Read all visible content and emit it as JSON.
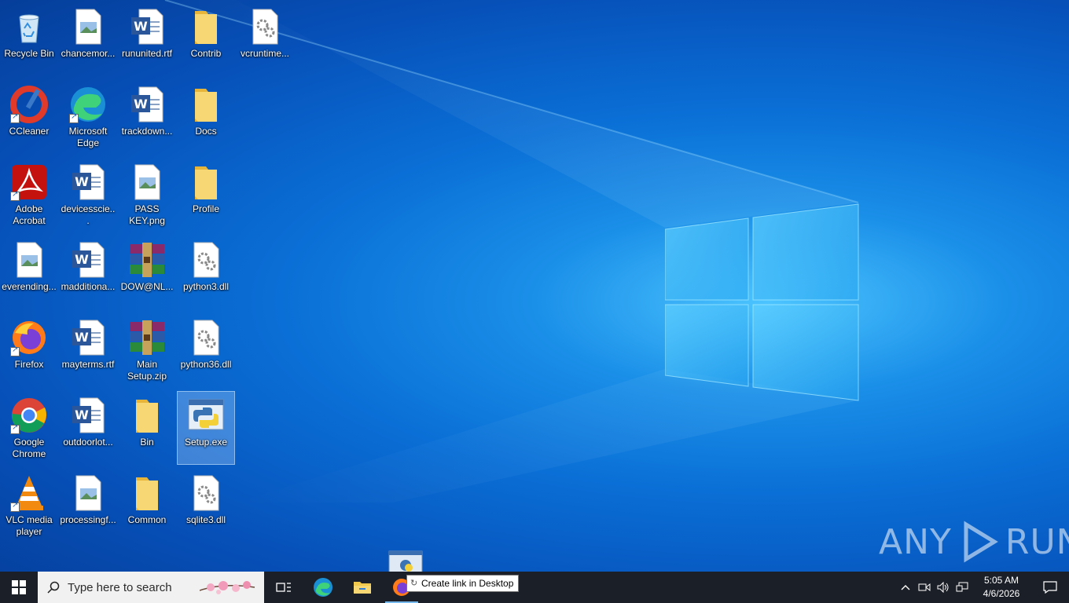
{
  "desktop": {
    "icons": [
      {
        "label": "Recycle Bin",
        "icon": "recycle-bin-icon"
      },
      {
        "label": "chancemor...",
        "icon": "image-file-icon"
      },
      {
        "label": "rununited.rtf",
        "icon": "word-doc-icon"
      },
      {
        "label": "Contrib",
        "icon": "folder-icon"
      },
      {
        "label": "vcruntime...",
        "icon": "dll-file-icon"
      },
      {
        "label": "CCleaner",
        "icon": "ccleaner-icon"
      },
      {
        "label": "Microsoft Edge",
        "icon": "edge-icon"
      },
      {
        "label": "trackdown...",
        "icon": "word-doc-icon"
      },
      {
        "label": "Docs",
        "icon": "folder-icon"
      },
      {
        "label": "Adobe Acrobat",
        "icon": "acrobat-icon"
      },
      {
        "label": "devicesscie...",
        "icon": "word-doc-icon"
      },
      {
        "label": "PASS KEY.png",
        "icon": "image-file-icon"
      },
      {
        "label": "Profile",
        "icon": "folder-icon"
      },
      {
        "label": "everending...",
        "icon": "image-file-icon"
      },
      {
        "label": "madditiona...",
        "icon": "word-doc-icon"
      },
      {
        "label": "DOW@NL...",
        "icon": "winrar-icon"
      },
      {
        "label": "python3.dll",
        "icon": "dll-file-icon"
      },
      {
        "label": "Firefox",
        "icon": "firefox-icon"
      },
      {
        "label": "mayterms.rtf",
        "icon": "word-doc-icon"
      },
      {
        "label": "Main Setup.zip",
        "icon": "winrar-icon"
      },
      {
        "label": "python36.dll",
        "icon": "dll-file-icon"
      },
      {
        "label": "Google Chrome",
        "icon": "chrome-icon"
      },
      {
        "label": "outdoorlot...",
        "icon": "word-doc-icon"
      },
      {
        "label": "Bin",
        "icon": "folder-icon"
      },
      {
        "label": "Setup.exe",
        "icon": "python-exe-icon"
      },
      {
        "label": "VLC media player",
        "icon": "vlc-icon"
      },
      {
        "label": "processingf...",
        "icon": "image-file-icon"
      },
      {
        "label": "Common",
        "icon": "folder-icon"
      },
      {
        "label": "sqlite3.dll",
        "icon": "dll-file-icon"
      }
    ]
  },
  "tooltip": {
    "text": "Create link in Desktop"
  },
  "watermark": {
    "text_left": "ANY",
    "text_right": "RUN"
  },
  "taskbar": {
    "search_placeholder": "Type here to search",
    "clock_time": "5:05 AM",
    "clock_date": "4/6/2026"
  },
  "colors": {
    "taskbar": "#1b1f27",
    "accent": "#76b9ed",
    "desktop": "#0a6fd6"
  }
}
